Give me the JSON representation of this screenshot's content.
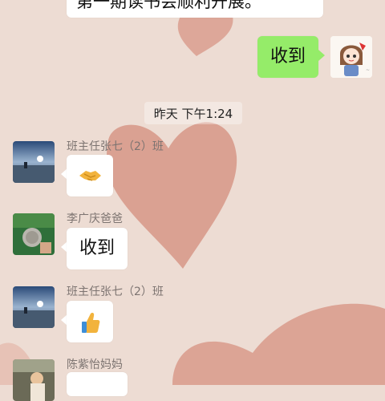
{
  "messages": [
    {
      "id": "m0",
      "sender": "",
      "text": "第一期读书会顺利开展。",
      "direction": "in",
      "partial": true
    },
    {
      "id": "m1",
      "sender": "",
      "text": "收到",
      "direction": "out"
    },
    {
      "id": "m2",
      "sender": "班主任张七（2）班",
      "text": "",
      "emoji": "handshake",
      "direction": "in"
    },
    {
      "id": "m3",
      "sender": "李广庆爸爸",
      "text": "收到",
      "direction": "in"
    },
    {
      "id": "m4",
      "sender": "班主任张七（2）班",
      "text": "",
      "emoji": "thumbs-up",
      "direction": "in"
    },
    {
      "id": "m5",
      "sender": "陈紫怡妈妈",
      "text": "",
      "direction": "in",
      "partial": true
    }
  ],
  "timestamp_label": "昨天 下午1:24",
  "colors": {
    "background": "#eddcd3",
    "heart": "#d99d8e",
    "outgoing_bubble": "#95ec69",
    "incoming_bubble": "#ffffff",
    "name_text": "#7d7471"
  }
}
